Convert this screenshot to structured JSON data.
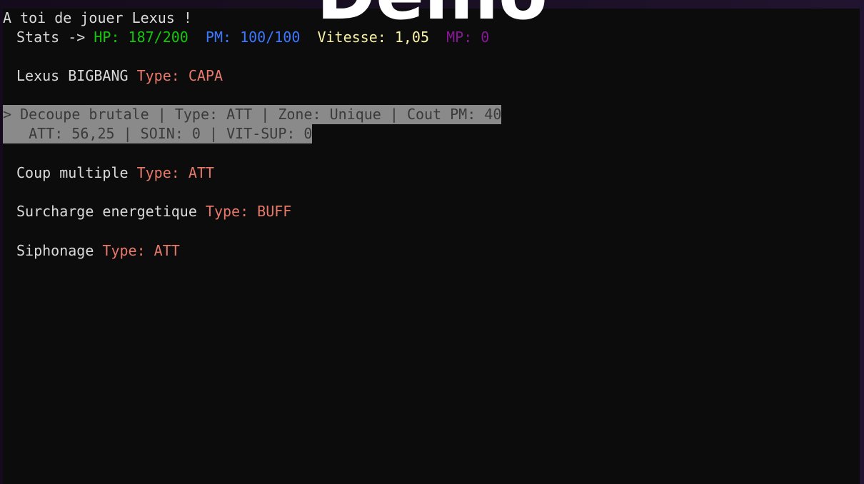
{
  "overlay": {
    "title": "Démo"
  },
  "terminal": {
    "prompt_line": "A toi de jouer Lexus !",
    "stats": {
      "prefix": "Stats -> ",
      "hp_label": "HP: 187/200",
      "pm_label": "PM: 100/100",
      "speed_label": "Vitesse: 1,05",
      "mp_label": "MP: 0"
    },
    "type_label": "Type: ",
    "skills": [
      {
        "name": "Lexus BIGBANG ",
        "type": "CAPA"
      },
      {
        "name": "Coup multiple ",
        "type": "ATT"
      },
      {
        "name": "Surcharge energetique ",
        "type": "BUFF"
      },
      {
        "name": "Siphonage ",
        "type": "ATT"
      }
    ],
    "selected": {
      "marker": "> ",
      "line1": "Decoupe brutale | Type: ATT | Zone: Unique | Cout PM: 40",
      "line2": "   ATT: 56,25 | SOIN: 0 | VIT-SUP: 0"
    }
  },
  "colors": {
    "background": "#0c0c0c",
    "hp": "#16c60c",
    "pm": "#3b78ff",
    "speed": "#f9f1a5",
    "mp": "#881798",
    "type": "#e7796a",
    "selection": "#8a8a8a"
  }
}
